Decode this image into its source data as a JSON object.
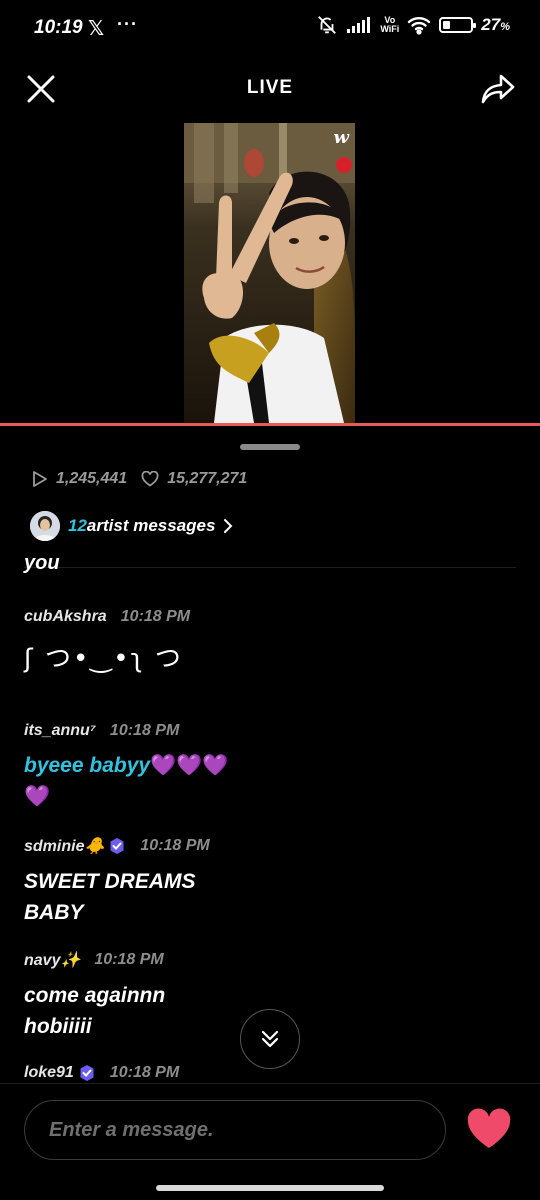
{
  "status_bar": {
    "time": "10:19",
    "x_glyph": "𝕏",
    "more": "···",
    "vowifi_top": "Vo",
    "vowifi_bottom": "WiFi",
    "battery_percent": "27",
    "battery_suffix": "%",
    "battery_level": 0.27
  },
  "header": {
    "title": "LIVE"
  },
  "video": {
    "logo": "w"
  },
  "stats": {
    "plays": "1,245,441",
    "likes": "15,277,271"
  },
  "artist_messages": {
    "count": "12",
    "label": "artist messages"
  },
  "chat": {
    "partial_text": "you",
    "messages": [
      {
        "user": "cubAkshra",
        "time": "10:18 PM",
        "body": "ʃ つ•‿•ʅ つ"
      },
      {
        "user": "its_annu⁷",
        "time": "10:18 PM",
        "body_text": "byeee babyy",
        "body_emoji_line1": "💜💜💜",
        "body_emoji_line2": "💜"
      },
      {
        "user": "sdminie🐥",
        "time": "10:18 PM",
        "body_line1": "SWEET DREAMS",
        "body_line2": "BABY"
      },
      {
        "user": "navy✨",
        "time": "10:18 PM",
        "body_line1": "come againnn",
        "body_line2": "hobiiiii"
      },
      {
        "user": "loke91",
        "time": "10:18 PM"
      }
    ]
  },
  "input": {
    "placeholder": "Enter a message."
  },
  "colors": {
    "accent_cyan": "#2ec4e0",
    "progress_red": "#e85a55",
    "heart": "#f04a6a",
    "badge_purple": "#6c5cf0"
  },
  "icons": [
    "close-icon",
    "share-icon",
    "play-icon",
    "heart-outline-icon",
    "chevron-right-icon",
    "verified-badge-icon",
    "double-chevron-down-icon",
    "heart-icon"
  ]
}
